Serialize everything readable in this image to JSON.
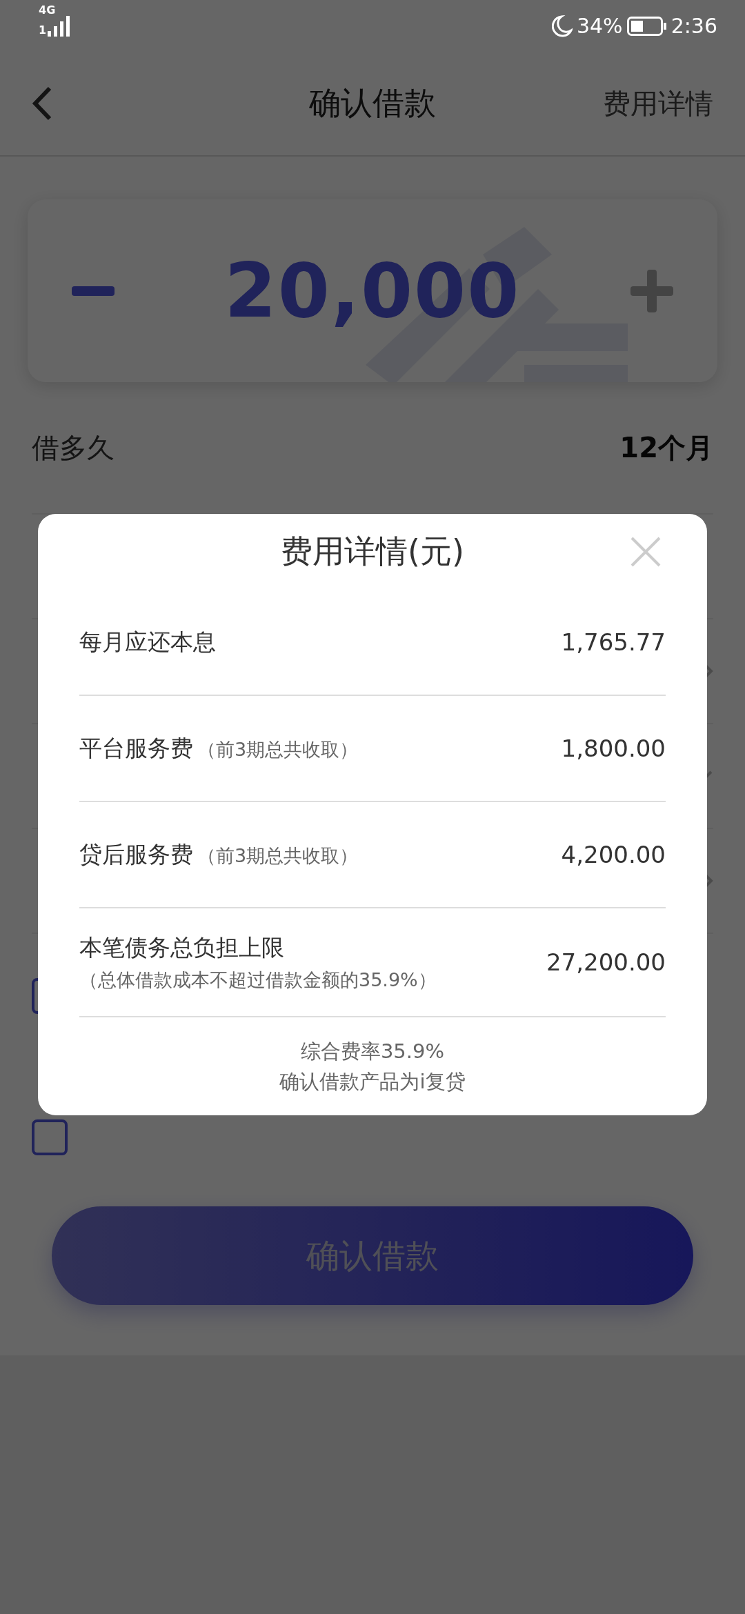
{
  "status_bar": {
    "sim": "1",
    "network": "4G",
    "battery": "34%",
    "time": "2:36"
  },
  "header": {
    "title": "确认借款",
    "action": "费用详情"
  },
  "amount": {
    "value": "20,000"
  },
  "term": {
    "label": "借多久",
    "value": "12个月"
  },
  "rows": [
    {
      "kind": "plain"
    },
    {
      "kind": "link"
    },
    {
      "kind": "select"
    },
    {
      "kind": "link"
    }
  ],
  "agreements": [
    {
      "checked": false
    },
    {
      "checked": false
    }
  ],
  "confirm_button": {
    "label": "确认借款",
    "disabled": true
  },
  "fee_dialog": {
    "title": "费用详情(元)",
    "items": [
      {
        "kind": "single",
        "label": "每月应还本息",
        "value": "1,765.77"
      },
      {
        "kind": "inline",
        "label": "平台服务费",
        "note": "（前3期总共收取）",
        "value": "1,800.00"
      },
      {
        "kind": "inline",
        "label": "贷后服务费",
        "note": "（前3期总共收取）",
        "value": "4,200.00"
      },
      {
        "kind": "stacked",
        "label": "本笔债务总负担上限",
        "note": "（总体借款成本不超过借款金额的35.9%）",
        "value": "27,200.00"
      }
    ],
    "footer": [
      "综合费率35.9%",
      "确认借款产品为i复贷"
    ]
  }
}
